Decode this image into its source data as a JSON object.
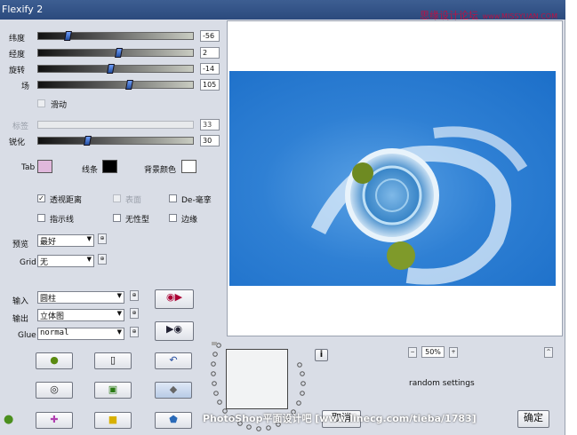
{
  "window": {
    "title": "Flexify 2"
  },
  "watermark_top": {
    "cn": "思缘设计论坛",
    "url": "www.MISSYUAN.COM"
  },
  "sliders": [
    {
      "label": "纬度",
      "value": "-56",
      "position": 0.18,
      "disabled": false
    },
    {
      "label": "经度",
      "value": "2",
      "position": 0.51,
      "disabled": false
    },
    {
      "label": "旋转",
      "value": "-14",
      "position": 0.46,
      "disabled": false
    },
    {
      "label": "场",
      "value": "105",
      "position": 0.58,
      "disabled": false
    }
  ],
  "smooth": {
    "label": "滑动",
    "checked": false
  },
  "sliders2": [
    {
      "label": "标签",
      "value": "33",
      "position": 0.0,
      "disabled": true
    },
    {
      "label": "锐化",
      "value": "30",
      "position": 0.3,
      "disabled": false
    }
  ],
  "colors": {
    "tab_label": "Tab",
    "tab_color": "#e0b8dc",
    "line_label": "线条",
    "line_color": "#000000",
    "bg_label": "背景颜色",
    "bg_color": "#ffffff"
  },
  "options": {
    "perspective": {
      "label": "透视距离",
      "checked": true
    },
    "surface": {
      "label": "表面",
      "checked": false,
      "disabled": true
    },
    "dehalo": {
      "label": "De-毫挛",
      "checked": false
    },
    "guides": {
      "label": "指示线",
      "checked": false
    },
    "noshape": {
      "label": "无性型",
      "checked": false
    },
    "edge": {
      "label": "边缘",
      "checked": false
    }
  },
  "preview": {
    "label": "预览",
    "value": "最好"
  },
  "grid": {
    "label": "Grid",
    "value": "无"
  },
  "input": {
    "label": "输入",
    "value": "圆柱"
  },
  "output": {
    "label": "输出",
    "value": "立体图"
  },
  "glue": {
    "label": "Glue",
    "value": "normal"
  },
  "zoom": {
    "minus": "−",
    "value": "50%",
    "plus": "+"
  },
  "random_settings": "random settings",
  "info_button": "i",
  "up_button": "^",
  "bottom_watermark": "PhotoShop平面设计吧 [www.linecg.com/tieba/1783]",
  "bottom_buttons": {
    "left": "取消",
    "right": "确定"
  }
}
